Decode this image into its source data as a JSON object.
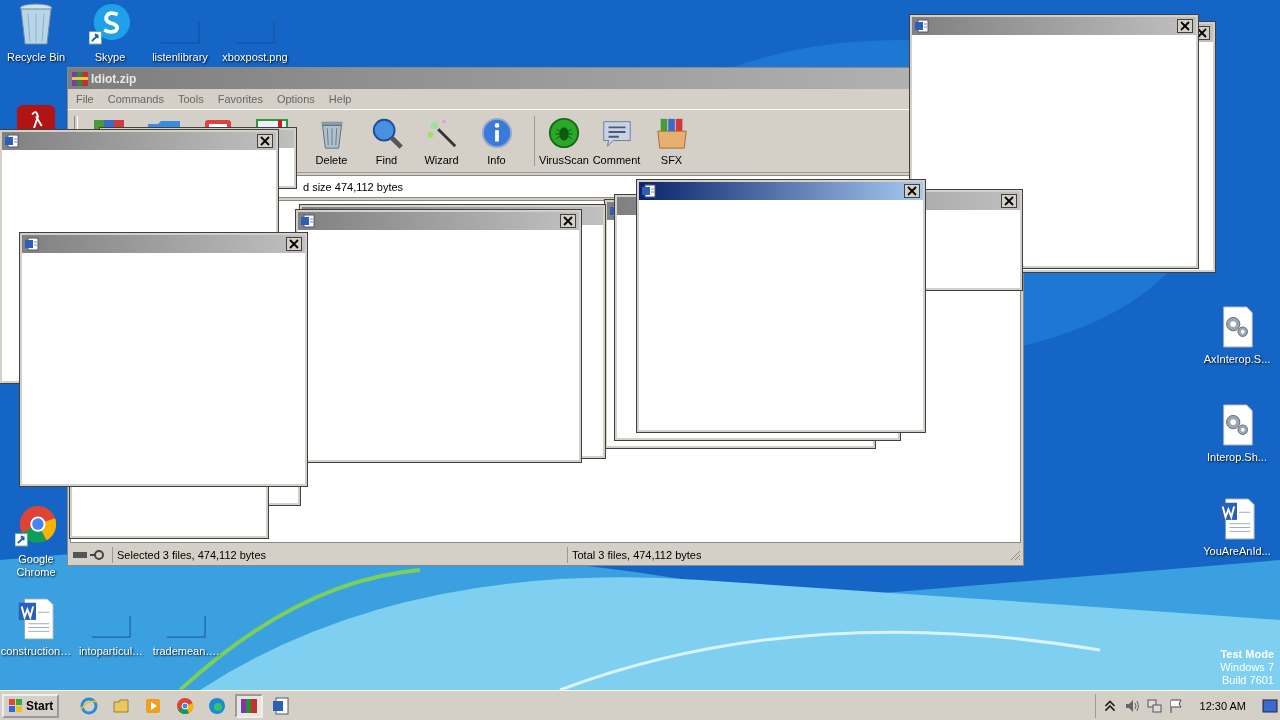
{
  "desktop": {
    "icons": [
      {
        "kind": "recycle-bin",
        "label": "Recycle Bin"
      },
      {
        "kind": "chat",
        "label": "Skype"
      },
      {
        "kind": "blank",
        "label": "listenlibrary"
      },
      {
        "kind": "blank",
        "label": "xboxpost.png"
      },
      {
        "kind": "red-app"
      },
      {
        "kind": "browser",
        "label": "Google Chrome"
      },
      {
        "kind": "word-doc",
        "label": "construction…"
      },
      {
        "kind": "blank",
        "label": "intoparticul…"
      },
      {
        "kind": "blank",
        "label": "trademean…."
      },
      {
        "kind": "config-file",
        "label": "AxInterop.S..."
      },
      {
        "kind": "config-file",
        "label": "Interop.Sh..."
      },
      {
        "kind": "word-doc",
        "label": "YouAreAnId..."
      }
    ],
    "os_notice": [
      "Test Mode",
      "Windows 7",
      "Build 7601"
    ]
  },
  "archive_window": {
    "title": "Idiot.zip",
    "menu": [
      "File",
      "Commands",
      "Tools",
      "Favorites",
      "Options",
      "Help"
    ],
    "toolbar": [
      {
        "kind": "trash",
        "label": "Delete"
      },
      {
        "kind": "magnifier",
        "label": "Find"
      },
      {
        "kind": "wand",
        "label": "Wizard"
      },
      {
        "kind": "info",
        "label": "Info"
      },
      {
        "kind": "bug",
        "label": "VirusScan"
      },
      {
        "kind": "comment",
        "label": "Comment"
      },
      {
        "kind": "box",
        "label": "SFX"
      }
    ],
    "info": "d size 474,112 bytes",
    "status": [
      "Selected 3 files, 474,112 bytes",
      "Total 3 files, 474,112 bytes"
    ]
  },
  "covered_windows": [
    {
      "kind": "dialog"
    },
    {
      "kind": "dialog"
    }
  ],
  "popups": [
    {
      "active": false
    },
    {
      "active": false
    },
    {
      "active": false
    },
    {
      "active": false
    },
    {
      "active": false
    },
    {
      "active": false
    },
    {
      "active": false
    },
    {
      "active": false
    },
    {
      "active": false
    },
    {
      "active": false
    },
    {
      "active": true
    }
  ],
  "taskbar": {
    "start": "Start",
    "items": [
      {
        "kind": "ie",
        "selected": false
      },
      {
        "kind": "folder",
        "selected": false
      },
      {
        "kind": "media",
        "selected": false
      },
      {
        "kind": "browser",
        "selected": false
      },
      {
        "kind": "edge",
        "selected": false
      },
      {
        "kind": "archiver",
        "selected": true
      },
      {
        "kind": "word",
        "selected": false
      }
    ],
    "clock": "12:30 AM"
  }
}
